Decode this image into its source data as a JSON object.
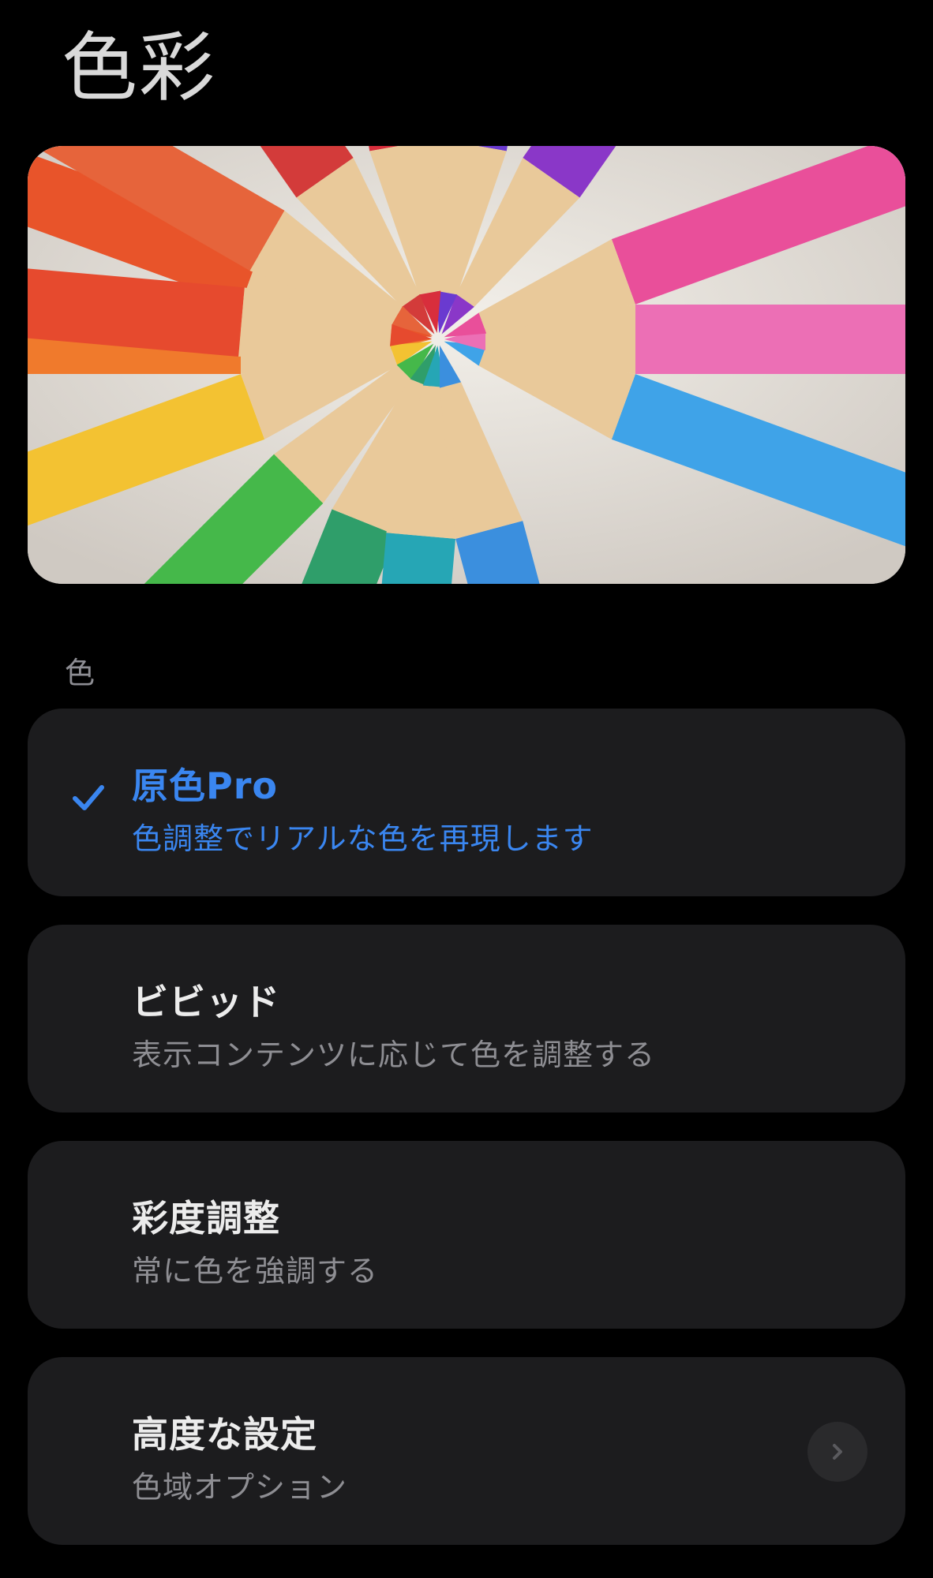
{
  "page": {
    "title": "色彩"
  },
  "hero": {
    "icon": "colored-pencils-image"
  },
  "section": {
    "label": "色"
  },
  "options": [
    {
      "title": "原色Pro",
      "subtitle": "色調整でリアルな色を再現します",
      "selected": true
    },
    {
      "title": "ビビッド",
      "subtitle": "表示コンテンツに応じて色を調整する",
      "selected": false
    },
    {
      "title": "彩度調整",
      "subtitle": "常に色を強調する",
      "selected": false
    }
  ],
  "advanced": {
    "title": "高度な設定",
    "subtitle": "色域オプション",
    "icon": "chevron-right-icon"
  },
  "colors": {
    "accent": "#3a86f0",
    "card_bg": "#1c1c1e",
    "background": "#000000"
  }
}
